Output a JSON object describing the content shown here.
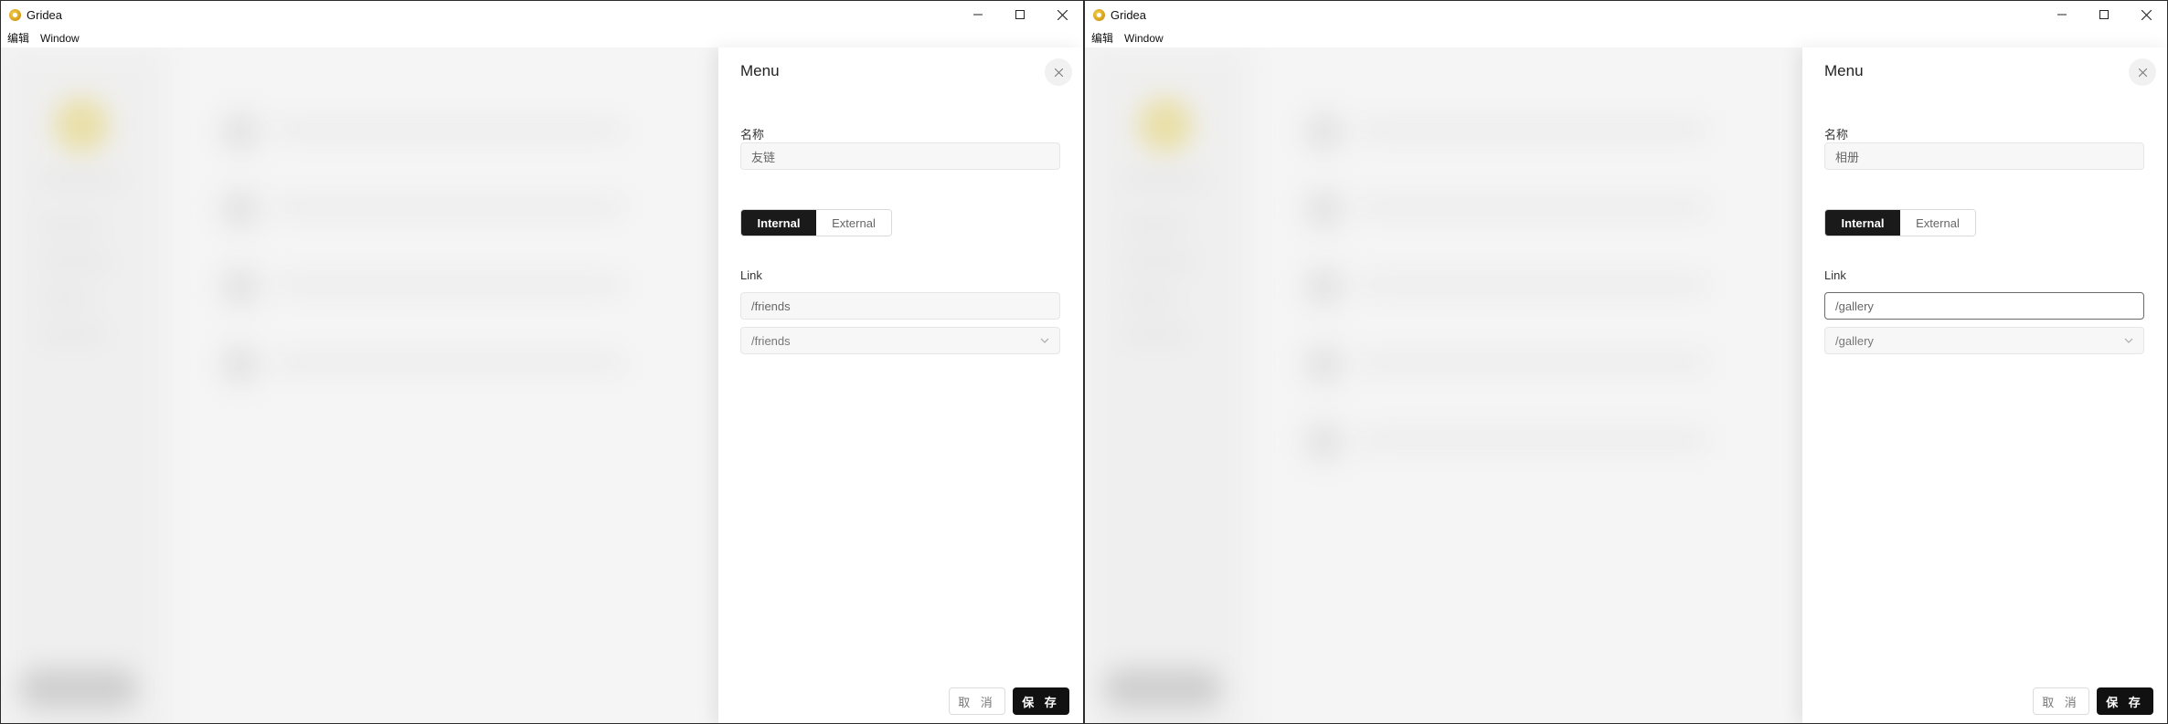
{
  "windows": [
    {
      "title": "Gridea",
      "menu": [
        "编辑",
        "Window"
      ],
      "drawer": {
        "title": "Menu",
        "name_label": "名称",
        "name_value": "友链",
        "link_type_options": [
          "Internal",
          "External"
        ],
        "link_type_selected": "Internal",
        "link_label": "Link",
        "link_value": "/friends",
        "link_select_value": "/friends",
        "cancel_label": "取 消",
        "save_label": "保 存"
      }
    },
    {
      "title": "Gridea",
      "menu": [
        "编辑",
        "Window"
      ],
      "drawer": {
        "title": "Menu",
        "name_label": "名称",
        "name_value": "相册",
        "link_type_options": [
          "Internal",
          "External"
        ],
        "link_type_selected": "Internal",
        "link_label": "Link",
        "link_value": "/gallery",
        "link_select_value": "/gallery",
        "cancel_label": "取 消",
        "save_label": "保 存"
      }
    }
  ],
  "icons": {
    "app": "gridea-logo-icon",
    "minimize": "minimize-icon",
    "maximize": "maximize-icon",
    "close": "close-icon",
    "drawer_close": "close-icon",
    "select": "chevron-down-icon"
  },
  "colors": {
    "primary_button": "#111111",
    "segment_active": "#1a1a1a",
    "input_background": "#f7f7f7"
  }
}
